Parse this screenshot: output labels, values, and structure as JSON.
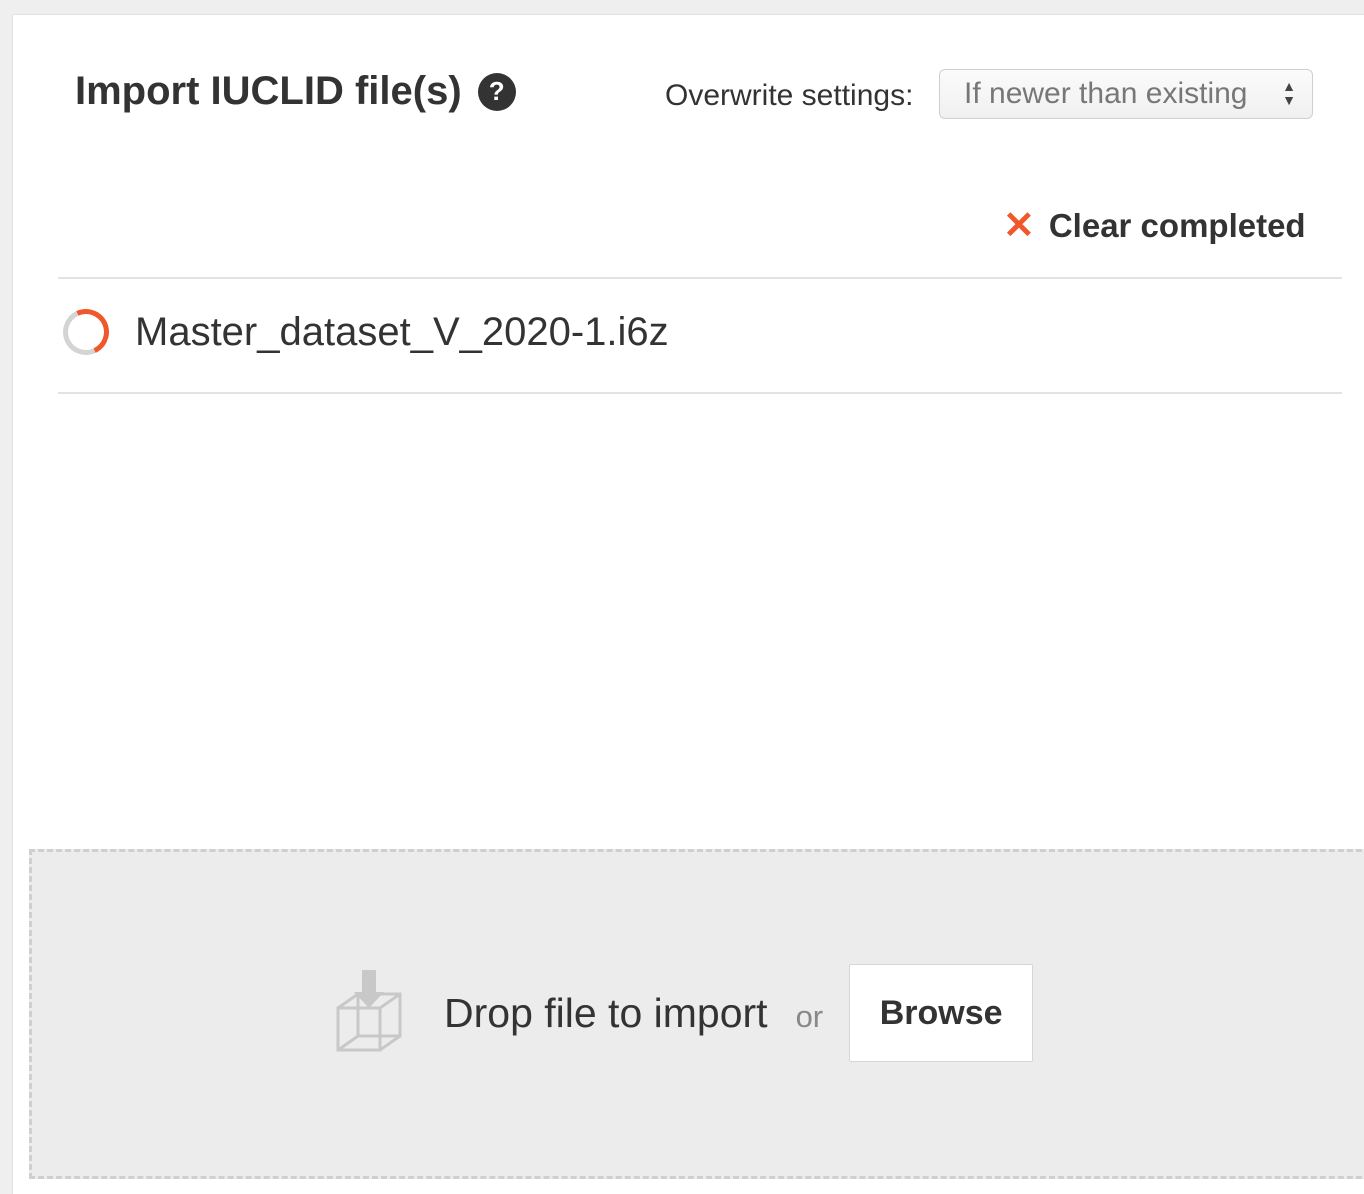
{
  "header": {
    "title": "Import IUCLID file(s)",
    "help_icon": "question-circle-icon",
    "help_glyph": "?"
  },
  "overwrite": {
    "label": "Overwrite settings:",
    "selected": "If newer than existing"
  },
  "clear": {
    "icon": "close-icon",
    "icon_glyph": "✕",
    "label": "Clear completed",
    "accent_color": "#f0582c"
  },
  "files": [
    {
      "name": "Master_dataset_V_2020-1.i6z",
      "status_icon": "loading-spinner-icon"
    }
  ],
  "dropzone": {
    "icon": "drop-box-icon",
    "label": "Drop file to import",
    "or_text": "or",
    "browse_label": "Browse"
  }
}
